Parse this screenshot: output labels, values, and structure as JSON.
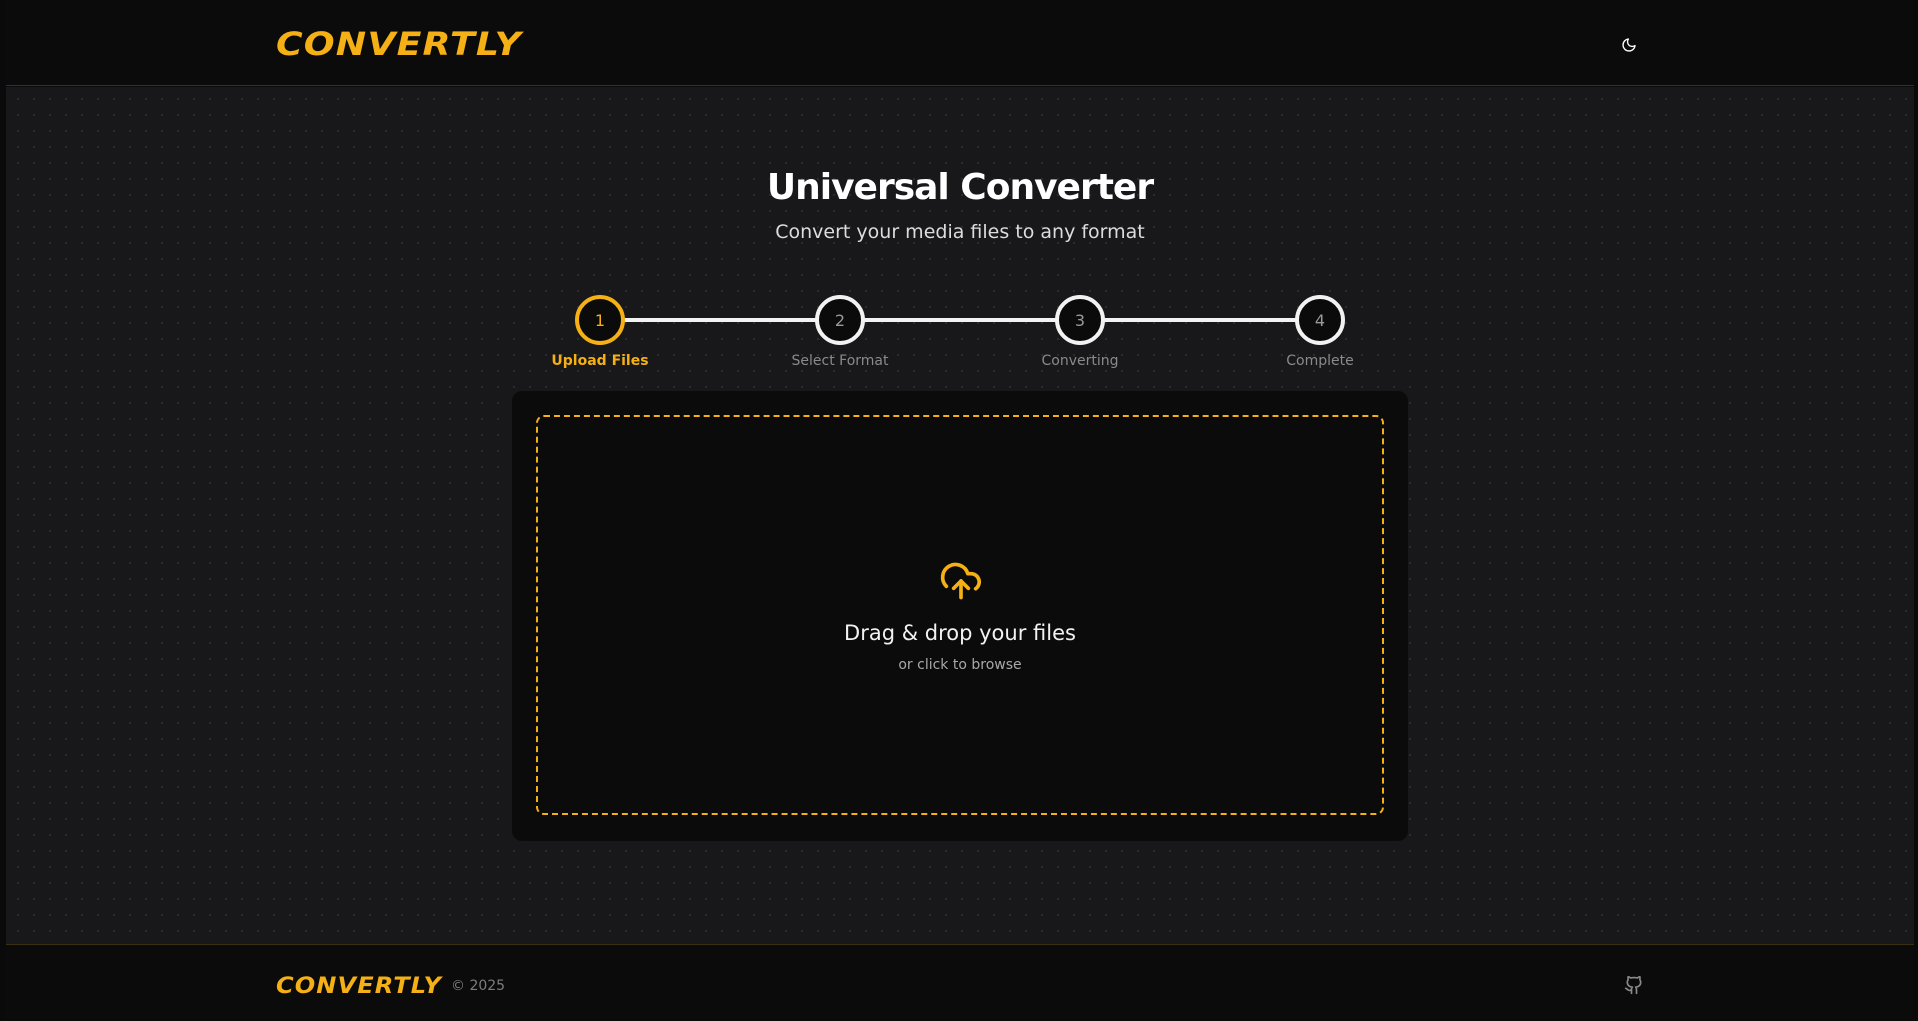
{
  "header": {
    "logo_text": "CONVERTLY",
    "theme_toggle_icon": "moon-icon"
  },
  "main": {
    "title": "Universal Converter",
    "subtitle": "Convert your media files to any format"
  },
  "stepper": {
    "steps": [
      {
        "number": "1",
        "label": "Upload Files",
        "active": true
      },
      {
        "number": "2",
        "label": "Select Format",
        "active": false
      },
      {
        "number": "3",
        "label": "Converting",
        "active": false
      },
      {
        "number": "4",
        "label": "Complete",
        "active": false
      }
    ]
  },
  "dropzone": {
    "icon": "cloud-upload-icon",
    "title": "Drag & drop your files",
    "subtitle": "or click to browse"
  },
  "footer": {
    "logo_text": "CONVERTLY",
    "copyright": "© 2025",
    "github_icon": "github-icon"
  },
  "colors": {
    "accent": "#f4b014",
    "background": "#18181a",
    "card": "#0b0b0b",
    "text": "#ffffff"
  }
}
